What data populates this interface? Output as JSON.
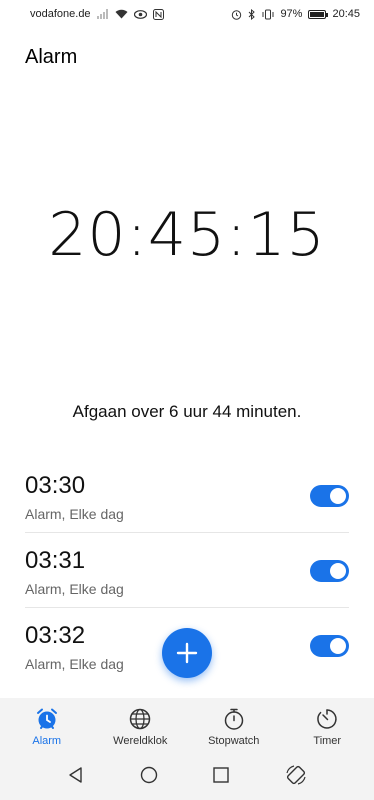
{
  "status_bar": {
    "carrier": "vodafone.de",
    "battery": "97%",
    "battery_level": 0.97,
    "time": "20:45"
  },
  "header": {
    "title": "Alarm"
  },
  "clock": {
    "time": "20:45:15"
  },
  "next_alarm": {
    "text": "Afgaan over 6 uur 44 minuten."
  },
  "alarms": [
    {
      "time": "03:30",
      "subtitle": "Alarm, Elke dag",
      "enabled": true
    },
    {
      "time": "03:31",
      "subtitle": "Alarm, Elke dag",
      "enabled": true
    },
    {
      "time": "03:32",
      "subtitle": "Alarm, Elke dag",
      "enabled": true
    }
  ],
  "tabs": [
    {
      "label": "Alarm",
      "icon": "alarm-clock-icon",
      "active": true
    },
    {
      "label": "Wereldklok",
      "icon": "globe-icon",
      "active": false
    },
    {
      "label": "Stopwatch",
      "icon": "stopwatch-icon",
      "active": false
    },
    {
      "label": "Timer",
      "icon": "timer-icon",
      "active": false
    }
  ],
  "colors": {
    "accent": "#1a73e8",
    "tab_bar_bg": "#f3f3f3"
  }
}
